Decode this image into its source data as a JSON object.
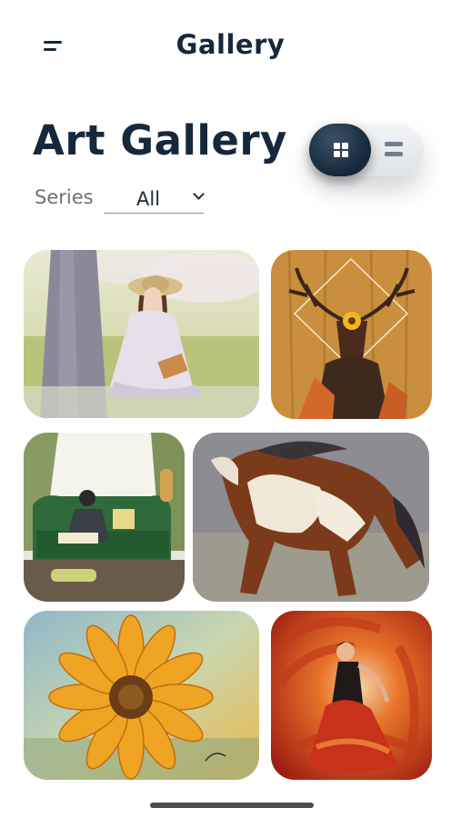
{
  "topbar": {
    "title": "Gallery",
    "menu_icon": "menu-icon"
  },
  "page": {
    "title": "Art Gallery"
  },
  "view_toggle": {
    "selected": "grid",
    "grid_icon": "grid-icon",
    "list_icon": "list-icon"
  },
  "filter": {
    "label": "Series",
    "selected": "All",
    "icon": "chevron-down-icon"
  },
  "colors": {
    "primary": "#16283b",
    "background": "#ffffff",
    "muted_text": "#6b7177"
  },
  "artworks": [
    {
      "subject": "girl-in-straw-hat-reading"
    },
    {
      "subject": "stag-and-foxes-on-wood"
    },
    {
      "subject": "woman-reading-on-green-sofa"
    },
    {
      "subject": "galloping-paint-horse"
    },
    {
      "subject": "sunflower"
    },
    {
      "subject": "flamenco-dancer"
    }
  ]
}
